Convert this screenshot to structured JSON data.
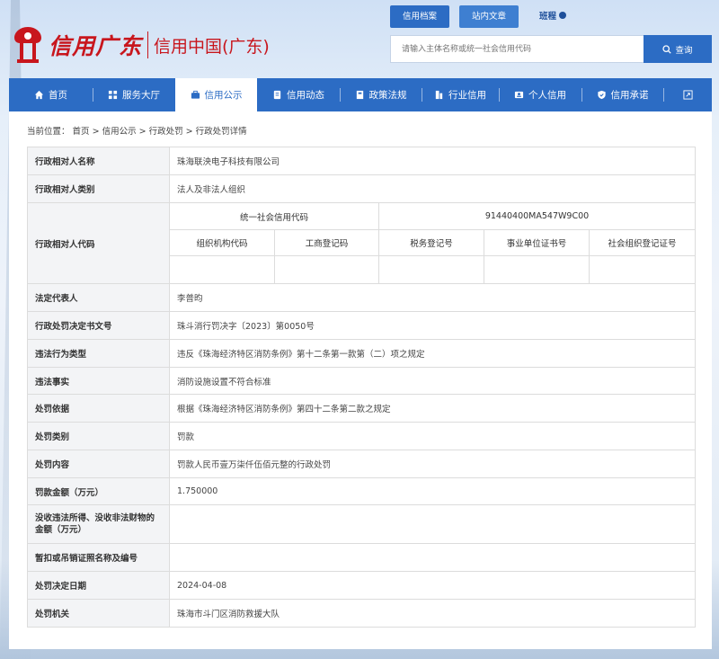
{
  "header": {
    "top_tabs": [
      "信用档案",
      "站内文章"
    ],
    "top_link": "班程",
    "logo_text": "信用广东",
    "logo_sub": "信用中国(广东)",
    "search_placeholder": "请输入主体名称或统一社会信用代码",
    "search_button": "查询"
  },
  "nav": {
    "items": [
      {
        "label": "首页",
        "icon": "home-icon"
      },
      {
        "label": "服务大厅",
        "icon": "grid-icon"
      },
      {
        "label": "信用公示",
        "icon": "briefcase-icon",
        "active": true
      },
      {
        "label": "信用动态",
        "icon": "document-icon"
      },
      {
        "label": "政策法规",
        "icon": "book-icon"
      },
      {
        "label": "行业信用",
        "icon": "building-icon"
      },
      {
        "label": "个人信用",
        "icon": "id-card-icon"
      },
      {
        "label": "信用承诺",
        "icon": "shield-icon"
      }
    ],
    "extra_icon": "expand-icon"
  },
  "breadcrumb": {
    "prefix": "当前位置：",
    "items": [
      "首页",
      "信用公示",
      "行政处罚",
      "行政处罚详情"
    ],
    "separator": " > "
  },
  "detail": {
    "name_label": "行政相对人名称",
    "name_value": "珠海联泱电子科技有限公司",
    "type_label": "行政相对人类别",
    "type_value": "法人及非法人组织",
    "code_label": "行政相对人代码",
    "uscc_label": "统一社会信用代码",
    "uscc_value": "91440400MA547W9C00",
    "code_cols": [
      "组织机构代码",
      "工商登记码",
      "税务登记号",
      "事业单位证书号",
      "社会组织登记证号"
    ],
    "legal_rep_label": "法定代表人",
    "legal_rep_value": "李普昀",
    "doc_no_label": "行政处罚决定书文号",
    "doc_no_value": "珠斗消行罚决字〔2023〕第0050号",
    "violation_type_label": "违法行为类型",
    "violation_type_value": "违反《珠海经济特区消防条例》第十二条第一款第（二）项之规定",
    "violation_fact_label": "违法事实",
    "violation_fact_value": "消防设施设置不符合标准",
    "basis_label": "处罚依据",
    "basis_value": "根据《珠海经济特区消防条例》第四十二条第二款之规定",
    "category_label": "处罚类别",
    "category_value": "罚款",
    "content_label": "处罚内容",
    "content_value": "罚款人民币壹万柒仟伍佰元整的行政处罚",
    "amount_label": "罚款金额（万元）",
    "amount_value": "1.750000",
    "confiscation_label": "没收违法所得、没收非法财物的金额（万元）",
    "confiscation_value": "",
    "license_label": "暂扣或吊销证照名称及编号",
    "license_value": "",
    "date_label": "处罚决定日期",
    "date_value": "2024-04-08",
    "authority_label": "处罚机关",
    "authority_value": "珠海市斗门区消防救援大队"
  },
  "colors": {
    "primary": "#2c6cc4",
    "logo_red": "#c8161d",
    "label_bg": "#f3f4f6"
  }
}
